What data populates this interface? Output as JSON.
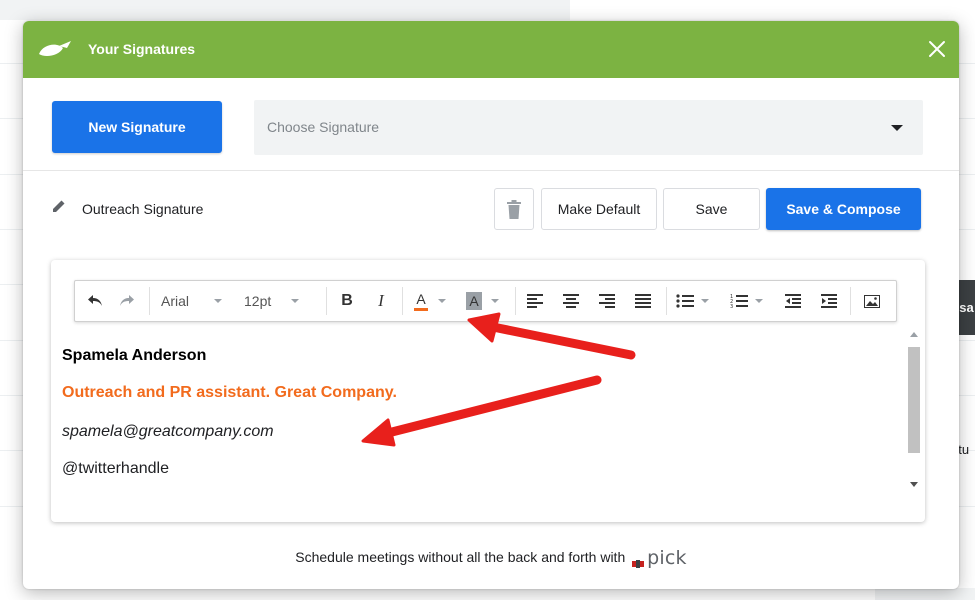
{
  "modal": {
    "title": "Your Signatures",
    "close_icon": "close-icon",
    "logo_icon": "leaf-logo-icon",
    "header_color": "#7cb342"
  },
  "top": {
    "new_signature_label": "New Signature",
    "choose_placeholder": "Choose Signature"
  },
  "signature": {
    "name": "Outreach Signature",
    "make_default_label": "Make Default",
    "save_label": "Save",
    "save_compose_label": "Save & Compose"
  },
  "toolbar": {
    "font_family": "Arial",
    "font_size": "12pt",
    "bold": "B",
    "italic": "I",
    "font_color": "A",
    "bg_color": "A",
    "icons": [
      "undo-icon",
      "redo-icon",
      "align-left-icon",
      "align-center-icon",
      "align-right-icon",
      "justify-icon",
      "bullet-list-icon",
      "numbered-list-icon",
      "outdent-icon",
      "indent-icon",
      "image-icon"
    ]
  },
  "content": {
    "name_line": "Spamela Anderson",
    "title_line": "Outreach and PR assistant. Great Company.",
    "email_line": "spamela@greatcompany.com",
    "handle_line": "@twitterhandle",
    "title_color": "#f26b1d"
  },
  "footer": {
    "text": "Schedule meetings without all the back and forth with",
    "brand": "pick"
  },
  "background": {
    "right_dark_text": "ssa",
    "right_text": "atu"
  },
  "colors": {
    "primary_button": "#1a73e8",
    "annotation_arrow": "#e8201c"
  }
}
